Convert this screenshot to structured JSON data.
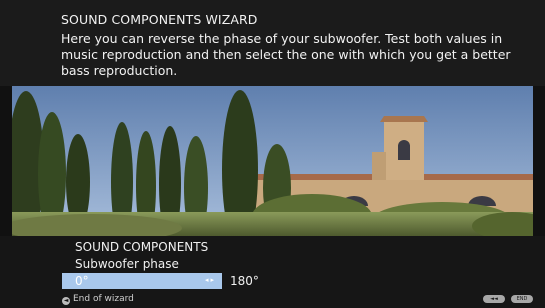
{
  "wizard": {
    "title": "SOUND COMPONENTS WIZARD",
    "description": "Here you can reverse the phase of your subwoofer. Test both values in music reproduction and then select the one with which you get a better bass reproduction."
  },
  "image": {
    "subject": "tuscan-church-with-cypress-trees"
  },
  "panel": {
    "title": "SOUND COMPONENTS",
    "setting_label": "Subwoofer phase",
    "options": [
      {
        "value": "0°",
        "selected": true
      },
      {
        "value": "180°",
        "selected": false
      }
    ],
    "selected_value": "0°",
    "other_value": "180°"
  },
  "footer": {
    "end_label": "End of wizard",
    "rewind_button": "◄◄",
    "end_button": "END"
  },
  "colors": {
    "selection": "#a9c8ec",
    "background": "#161616"
  }
}
